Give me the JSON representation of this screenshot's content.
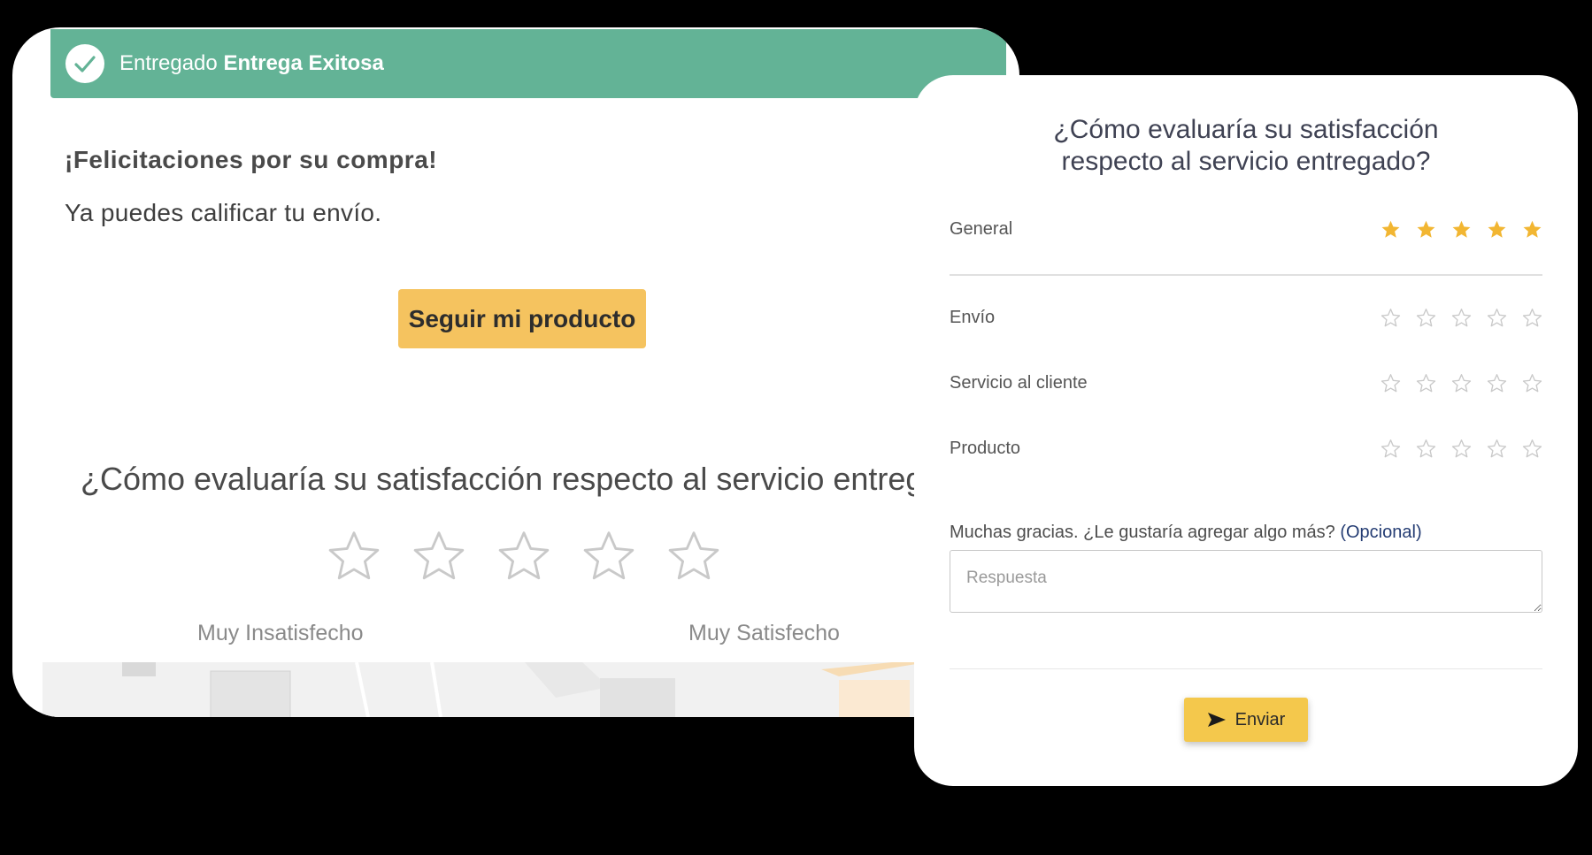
{
  "colors": {
    "status_green": "#63b396",
    "accent_yellow": "#f5c35f",
    "star_filled": "#f2b632",
    "star_empty": "#c9c9c9"
  },
  "delivery": {
    "status_icon": "check-icon",
    "status_prefix": "Entregado",
    "status_value": "Entrega Exitosa",
    "congrats": "¡Felicitaciones por su compra!",
    "subtitle": "Ya puedes calificar tu envío.",
    "track_button": "Seguir mi producto",
    "question": "¿Cómo evaluaría su satisfacción respecto al servicio entrega",
    "star_count": 5,
    "scale_low": "Muy Insatisfecho",
    "scale_high": "Muy Satisfecho"
  },
  "survey": {
    "title_line1": "¿Cómo evaluaría su satisfacción",
    "title_line2": "respecto al servicio entregado?",
    "ratings": [
      {
        "label": "General",
        "value": 5,
        "max": 5
      },
      {
        "label": "Envío",
        "value": 0,
        "max": 5
      },
      {
        "label": "Servicio al cliente",
        "value": 0,
        "max": 5
      },
      {
        "label": "Producto",
        "value": 0,
        "max": 5
      }
    ],
    "comment_label": "Muchas gracias. ¿Le gustaría agregar algo más?",
    "comment_optional": "(Opcional)",
    "comment_placeholder": "Respuesta",
    "comment_value": "",
    "send_icon": "send-arrow-icon",
    "send_label": "Enviar"
  }
}
